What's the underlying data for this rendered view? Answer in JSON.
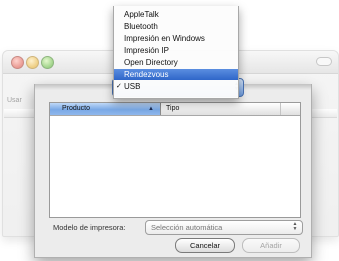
{
  "background_window": {
    "label": "Usar"
  },
  "menu": {
    "items": [
      {
        "label": "AppleTalk",
        "selected": false,
        "checked": false
      },
      {
        "label": "Bluetooth",
        "selected": false,
        "checked": false
      },
      {
        "label": "Impresión en Windows",
        "selected": false,
        "checked": false
      },
      {
        "label": "Impresión IP",
        "selected": false,
        "checked": false
      },
      {
        "label": "Open Directory",
        "selected": false,
        "checked": false
      },
      {
        "label": "Rendezvous",
        "selected": true,
        "checked": false
      },
      {
        "label": "USB",
        "selected": false,
        "checked": true
      }
    ],
    "check_glyph": "✓"
  },
  "table": {
    "columns": [
      {
        "label": "Producto",
        "sorted": true,
        "sort_glyph": "▲"
      },
      {
        "label": "Tipo",
        "sorted": false
      }
    ],
    "rows": []
  },
  "model": {
    "label": "Modelo de impresora:",
    "value": "Selección automática"
  },
  "buttons": {
    "cancel": "Cancelar",
    "add": "Añadir"
  },
  "colors": {
    "selection": "#3a72d0",
    "header_sorted": "#7aa9e6"
  },
  "icons": {
    "popup_arrows": "up-down-arrows-icon",
    "checkmark": "check-icon"
  }
}
